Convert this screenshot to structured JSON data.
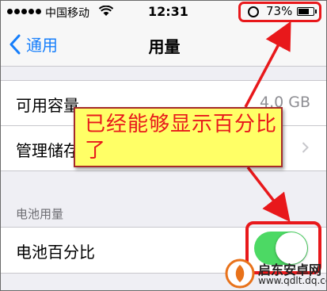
{
  "status_bar": {
    "carrier": "中国移动",
    "time": "12:31",
    "battery_percent": "73%",
    "battery_level": 0.73
  },
  "nav": {
    "back_label": "通用",
    "title": "用量"
  },
  "storage_rows": [
    {
      "label": "可用容量",
      "value": "4.0 GB"
    },
    {
      "label": "管理储存空间"
    }
  ],
  "battery_section": {
    "header": "电池用量",
    "row_label": "电池百分比",
    "toggle_on": true
  },
  "annotation": {
    "text": "已经能够显示百分比了"
  },
  "watermark": {
    "name": "启东安卓网",
    "url": "www.qdlt.dq.com"
  },
  "colors": {
    "accent": "#157efb",
    "toggle_on": "#4cd964",
    "highlight_red": "#e8181b",
    "callout_fill": "#ffff66"
  }
}
